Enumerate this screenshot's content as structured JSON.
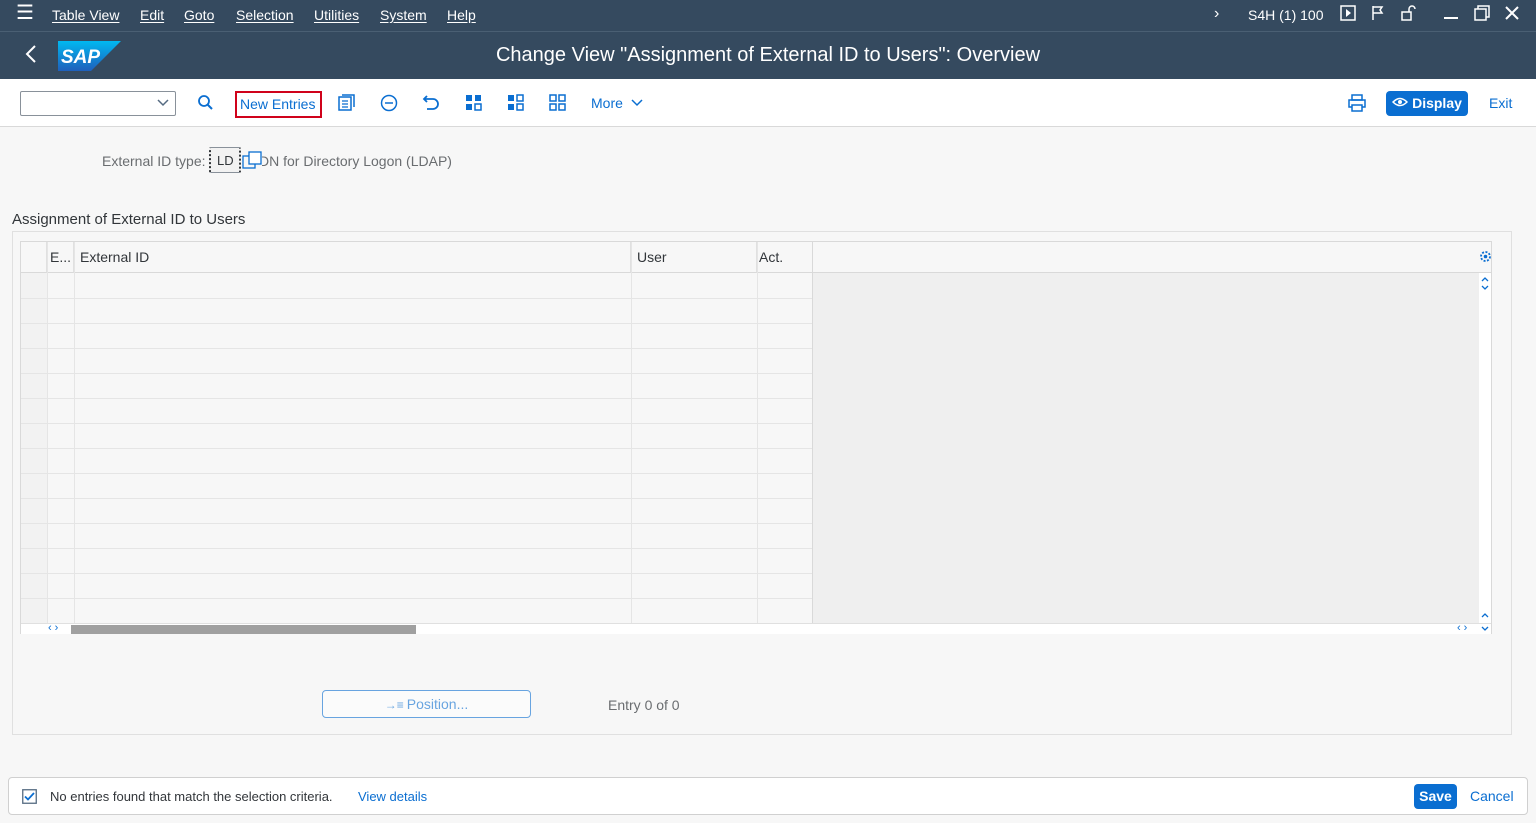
{
  "menu": {
    "items": [
      "Table View",
      "Edit",
      "Goto",
      "Selection",
      "Utilities",
      "System",
      "Help"
    ],
    "system_info": "S4H (1) 100"
  },
  "header": {
    "title": "Change View \"Assignment of External ID to Users\": Overview",
    "logo_text": "SAP"
  },
  "toolbar": {
    "new_entries": "New Entries",
    "more": "More",
    "display": "Display",
    "exit": "Exit"
  },
  "filter": {
    "label": "External ID type:",
    "value": "LD",
    "description": "DN for Directory Logon (LDAP)"
  },
  "table": {
    "title": "Assignment of External ID to Users",
    "columns": [
      "E...",
      "External ID",
      "User",
      "Act."
    ],
    "rows": []
  },
  "position_button": "Position...",
  "entry_count": "Entry 0 of 0",
  "status": {
    "message": "No entries found that match the selection criteria.",
    "link": "View details"
  },
  "footer": {
    "save": "Save",
    "cancel": "Cancel"
  },
  "colors": {
    "shell": "#354a5f",
    "accent": "#0a6ed1",
    "highlight_border": "#d0021b"
  }
}
